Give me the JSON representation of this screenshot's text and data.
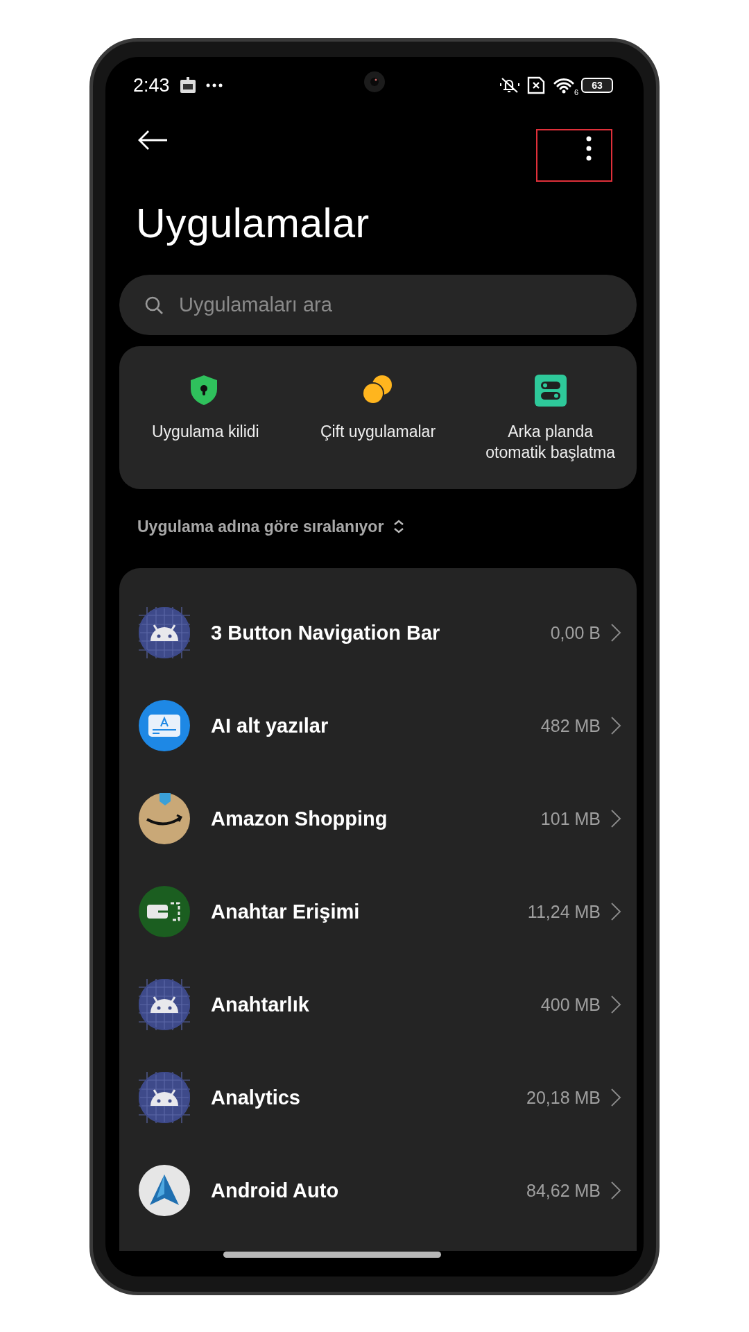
{
  "status_bar": {
    "time": "2:43",
    "wifi_label": "6",
    "battery": "63"
  },
  "title": "Uygulamalar",
  "search": {
    "placeholder": "Uygulamaları ara"
  },
  "shortcuts": [
    {
      "kind": "lock",
      "label": "Uygulama kilidi"
    },
    {
      "kind": "dual",
      "label": "Çift uygulamalar"
    },
    {
      "kind": "autostart",
      "label": "Arka planda otomatik başlatma"
    }
  ],
  "sort": {
    "label": "Uygulama adına göre sıralanıyor"
  },
  "apps": [
    {
      "kind": "android",
      "name": "3 Button Navigation Bar",
      "size": "0,00 B"
    },
    {
      "kind": "captions",
      "name": "AI alt yazılar",
      "size": "482 MB"
    },
    {
      "kind": "amazon",
      "name": "Amazon Shopping",
      "size": "101 MB"
    },
    {
      "kind": "passkey",
      "name": "Anahtar Erişimi",
      "size": "11,24 MB"
    },
    {
      "kind": "android",
      "name": "Anahtarlık",
      "size": "400 MB"
    },
    {
      "kind": "android",
      "name": "Analytics",
      "size": "20,18 MB"
    },
    {
      "kind": "auto",
      "name": "Android Auto",
      "size": "84,62 MB"
    }
  ]
}
